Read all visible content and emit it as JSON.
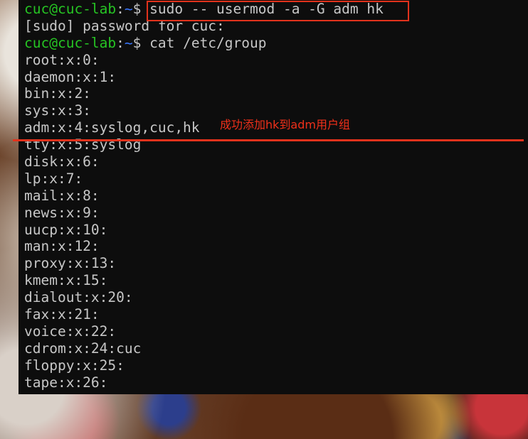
{
  "terminal": {
    "prompt": {
      "user_host": "cuc@cuc-lab",
      "separator": ":",
      "path": "~",
      "symbol": "$ "
    },
    "command_1": "sudo -- usermod -a -G adm hk",
    "sudo_prompt": "[sudo] password for cuc:",
    "command_2": "cat /etc/group",
    "group_lines": [
      "root:x:0:",
      "daemon:x:1:",
      "bin:x:2:",
      "sys:x:3:",
      "adm:x:4:syslog,cuc,hk",
      "tty:x:5:syslog",
      "disk:x:6:",
      "lp:x:7:",
      "mail:x:8:",
      "news:x:9:",
      "uucp:x:10:",
      "man:x:12:",
      "proxy:x:13:",
      "kmem:x:15:",
      "dialout:x:20:",
      "fax:x:21:",
      "voice:x:22:",
      "cdrom:x:24:cuc",
      "floppy:x:25:",
      "tape:x:26:"
    ]
  },
  "annotation": {
    "text": "成功添加hk到adm用户组",
    "color": "#e2321c"
  },
  "colors": {
    "terminal_bg": "#0d0d0d",
    "text": "#c7c7c7",
    "prompt_user": "#26c423",
    "prompt_path": "#3b78ff"
  }
}
